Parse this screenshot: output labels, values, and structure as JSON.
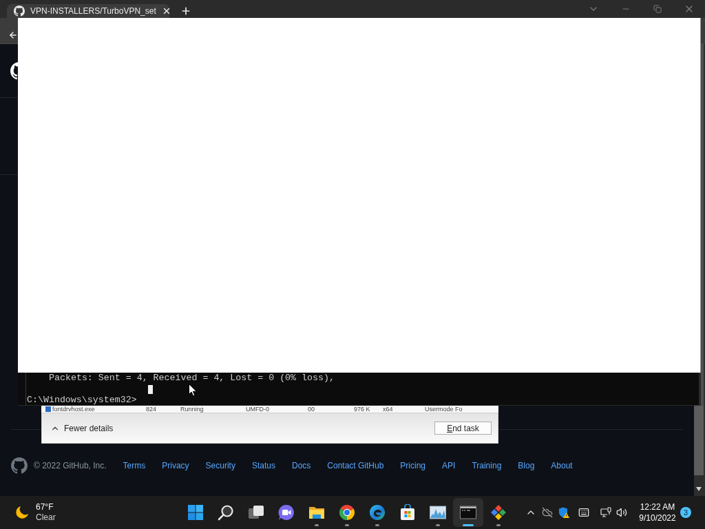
{
  "browser": {
    "tabs": [
      {
        "title": "VPN-INSTALLERS/TurboVPN_set",
        "selected": true
      }
    ]
  },
  "github_footer": {
    "copyright": "© 2022 GitHub, Inc.",
    "links": [
      "Terms",
      "Privacy",
      "Security",
      "Status",
      "Docs",
      "Contact GitHub",
      "Pricing",
      "API",
      "Training",
      "Blog",
      "About"
    ]
  },
  "console": {
    "lines": [
      {
        "kind": "output",
        "text": "Packets: Sent = 4, Received = 4, Lost = 0 (0% loss),"
      },
      {
        "kind": "cursor"
      },
      {
        "kind": "prompt",
        "text": "C:\\Windows\\system32>"
      }
    ]
  },
  "task_manager": {
    "process_row": [
      "fontdrvhost.exe",
      "824",
      "Running",
      "UMFD-0",
      "00",
      "976 K",
      "x64",
      "Usermode Fo"
    ],
    "details_toggle": "Fewer details",
    "end_task_button": "End task"
  },
  "taskbar": {
    "weather": {
      "temperature": "67°F",
      "condition": "Clear"
    },
    "apps": [
      {
        "kind": "start",
        "running": false,
        "active": false
      },
      {
        "kind": "search",
        "running": false,
        "active": false
      },
      {
        "kind": "task_view",
        "running": false,
        "active": false
      },
      {
        "kind": "chat",
        "running": false,
        "active": false
      },
      {
        "kind": "file_explorer",
        "running": true,
        "active": false
      },
      {
        "kind": "chrome",
        "running": true,
        "active": false
      },
      {
        "kind": "edge",
        "running": true,
        "active": false
      },
      {
        "kind": "store",
        "running": false,
        "active": false
      },
      {
        "kind": "resource_monitor",
        "running": true,
        "active": false
      },
      {
        "kind": "command_prompt",
        "running": true,
        "active": true
      },
      {
        "kind": "pinned_app",
        "running": true,
        "active": false
      }
    ],
    "clock": {
      "time": "12:22 AM",
      "date": "9/10/2022"
    },
    "notifications": "3"
  }
}
